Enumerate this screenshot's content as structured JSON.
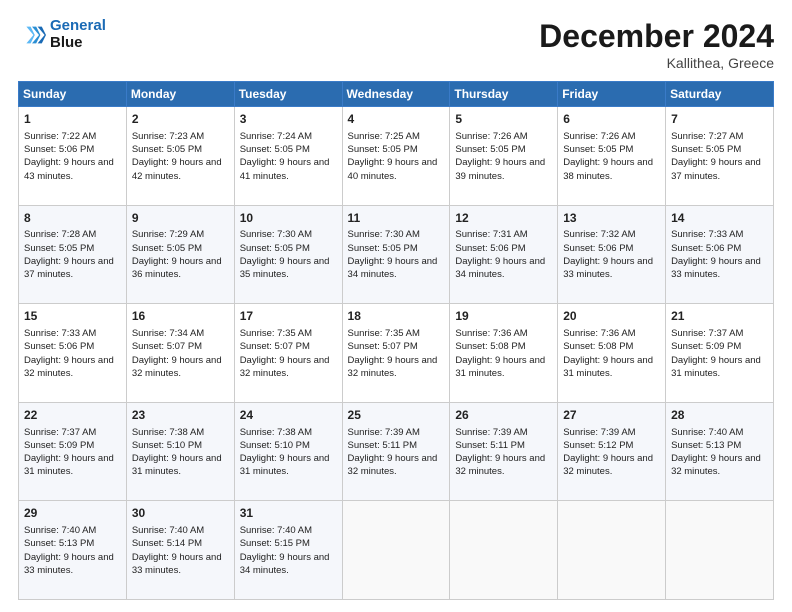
{
  "header": {
    "logo_line1": "General",
    "logo_line2": "Blue",
    "month": "December 2024",
    "location": "Kallithea, Greece"
  },
  "weekdays": [
    "Sunday",
    "Monday",
    "Tuesday",
    "Wednesday",
    "Thursday",
    "Friday",
    "Saturday"
  ],
  "weeks": [
    [
      {
        "day": "1",
        "sunrise": "7:22 AM",
        "sunset": "5:06 PM",
        "daylight": "9 hours and 43 minutes."
      },
      {
        "day": "2",
        "sunrise": "7:23 AM",
        "sunset": "5:05 PM",
        "daylight": "9 hours and 42 minutes."
      },
      {
        "day": "3",
        "sunrise": "7:24 AM",
        "sunset": "5:05 PM",
        "daylight": "9 hours and 41 minutes."
      },
      {
        "day": "4",
        "sunrise": "7:25 AM",
        "sunset": "5:05 PM",
        "daylight": "9 hours and 40 minutes."
      },
      {
        "day": "5",
        "sunrise": "7:26 AM",
        "sunset": "5:05 PM",
        "daylight": "9 hours and 39 minutes."
      },
      {
        "day": "6",
        "sunrise": "7:26 AM",
        "sunset": "5:05 PM",
        "daylight": "9 hours and 38 minutes."
      },
      {
        "day": "7",
        "sunrise": "7:27 AM",
        "sunset": "5:05 PM",
        "daylight": "9 hours and 37 minutes."
      }
    ],
    [
      {
        "day": "8",
        "sunrise": "7:28 AM",
        "sunset": "5:05 PM",
        "daylight": "9 hours and 37 minutes."
      },
      {
        "day": "9",
        "sunrise": "7:29 AM",
        "sunset": "5:05 PM",
        "daylight": "9 hours and 36 minutes."
      },
      {
        "day": "10",
        "sunrise": "7:30 AM",
        "sunset": "5:05 PM",
        "daylight": "9 hours and 35 minutes."
      },
      {
        "day": "11",
        "sunrise": "7:30 AM",
        "sunset": "5:05 PM",
        "daylight": "9 hours and 34 minutes."
      },
      {
        "day": "12",
        "sunrise": "7:31 AM",
        "sunset": "5:06 PM",
        "daylight": "9 hours and 34 minutes."
      },
      {
        "day": "13",
        "sunrise": "7:32 AM",
        "sunset": "5:06 PM",
        "daylight": "9 hours and 33 minutes."
      },
      {
        "day": "14",
        "sunrise": "7:33 AM",
        "sunset": "5:06 PM",
        "daylight": "9 hours and 33 minutes."
      }
    ],
    [
      {
        "day": "15",
        "sunrise": "7:33 AM",
        "sunset": "5:06 PM",
        "daylight": "9 hours and 32 minutes."
      },
      {
        "day": "16",
        "sunrise": "7:34 AM",
        "sunset": "5:07 PM",
        "daylight": "9 hours and 32 minutes."
      },
      {
        "day": "17",
        "sunrise": "7:35 AM",
        "sunset": "5:07 PM",
        "daylight": "9 hours and 32 minutes."
      },
      {
        "day": "18",
        "sunrise": "7:35 AM",
        "sunset": "5:07 PM",
        "daylight": "9 hours and 32 minutes."
      },
      {
        "day": "19",
        "sunrise": "7:36 AM",
        "sunset": "5:08 PM",
        "daylight": "9 hours and 31 minutes."
      },
      {
        "day": "20",
        "sunrise": "7:36 AM",
        "sunset": "5:08 PM",
        "daylight": "9 hours and 31 minutes."
      },
      {
        "day": "21",
        "sunrise": "7:37 AM",
        "sunset": "5:09 PM",
        "daylight": "9 hours and 31 minutes."
      }
    ],
    [
      {
        "day": "22",
        "sunrise": "7:37 AM",
        "sunset": "5:09 PM",
        "daylight": "9 hours and 31 minutes."
      },
      {
        "day": "23",
        "sunrise": "7:38 AM",
        "sunset": "5:10 PM",
        "daylight": "9 hours and 31 minutes."
      },
      {
        "day": "24",
        "sunrise": "7:38 AM",
        "sunset": "5:10 PM",
        "daylight": "9 hours and 31 minutes."
      },
      {
        "day": "25",
        "sunrise": "7:39 AM",
        "sunset": "5:11 PM",
        "daylight": "9 hours and 32 minutes."
      },
      {
        "day": "26",
        "sunrise": "7:39 AM",
        "sunset": "5:11 PM",
        "daylight": "9 hours and 32 minutes."
      },
      {
        "day": "27",
        "sunrise": "7:39 AM",
        "sunset": "5:12 PM",
        "daylight": "9 hours and 32 minutes."
      },
      {
        "day": "28",
        "sunrise": "7:40 AM",
        "sunset": "5:13 PM",
        "daylight": "9 hours and 32 minutes."
      }
    ],
    [
      {
        "day": "29",
        "sunrise": "7:40 AM",
        "sunset": "5:13 PM",
        "daylight": "9 hours and 33 minutes."
      },
      {
        "day": "30",
        "sunrise": "7:40 AM",
        "sunset": "5:14 PM",
        "daylight": "9 hours and 33 minutes."
      },
      {
        "day": "31",
        "sunrise": "7:40 AM",
        "sunset": "5:15 PM",
        "daylight": "9 hours and 34 minutes."
      },
      null,
      null,
      null,
      null
    ]
  ]
}
